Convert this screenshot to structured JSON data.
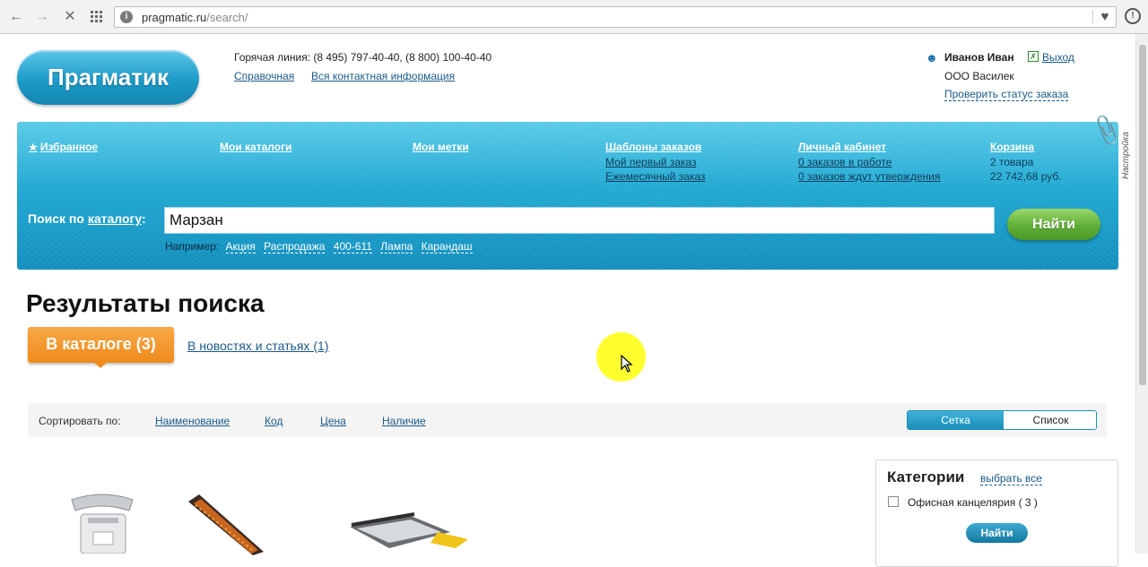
{
  "browser": {
    "url_host": "pragmatic.ru",
    "url_path": "/search/",
    "back_icon": "arrow-left-icon",
    "forward_icon": "arrow-right-icon",
    "stop_icon": "close-icon",
    "apps_icon": "grid-icon",
    "bookmark_icon": "heart-icon"
  },
  "header": {
    "logo": "Прагматик",
    "hotline": "Горячая линия: (8 495) 797-40-40, (8 800) 100-40-40",
    "help_link": "Справочная",
    "contacts_link": "Вся контактная информация",
    "user_name": "Иванов Иван",
    "logout": "Выход",
    "company": "ООО Василек",
    "order_status": "Проверить статус заказа"
  },
  "nav": {
    "favorites": "Избранное",
    "catalogs": "Мои каталоги",
    "tags": "Мои метки",
    "templates": {
      "title": "Шаблоны заказов",
      "items": [
        "Мой первый заказ",
        "Ежемесячный заказ"
      ]
    },
    "cabinet": {
      "title": "Личный кабинет",
      "items": [
        "0 заказов в работе",
        "0 заказов ждут утверждения"
      ]
    },
    "cart": {
      "title": "Корзина",
      "count": "2 товара",
      "sum": "22 742,68 руб."
    },
    "settings_label": "Настройка"
  },
  "search": {
    "label_prefix": "Поиск по ",
    "label_link": "каталогу",
    "label_suffix": ":",
    "value": "Марзан",
    "button": "Найти",
    "examples_label": "Например:",
    "examples": [
      "Акция",
      "Распродажа",
      "400-611",
      "Лампа",
      "Карандаш"
    ]
  },
  "results": {
    "title": "Результаты поиска",
    "tab_catalog": "В каталоге (3)",
    "tab_news": "В новостях и статьях (1)"
  },
  "sort": {
    "label": "Сортировать по:",
    "options": [
      "Наименование",
      "Код",
      "Цена",
      "Наличие"
    ],
    "view_grid": "Сетка",
    "view_list": "Список"
  },
  "categories": {
    "title": "Категории",
    "select_all": "выбрать все",
    "items": [
      {
        "label": "Офисная канцелярия ( 3 )",
        "checked": false
      }
    ],
    "apply_button": "Найти"
  },
  "colors": {
    "brand_blue": "#22a9d3",
    "accent_orange": "#ef8a1c",
    "find_green": "#5fae37",
    "link_blue": "#1a5a8a"
  }
}
